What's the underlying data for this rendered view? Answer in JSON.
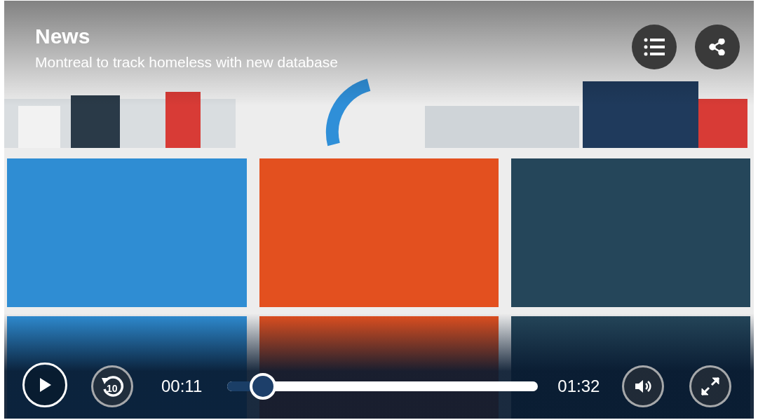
{
  "header": {
    "category": "News",
    "title": "Montreal to track homeless with new database"
  },
  "controls": {
    "playing": false,
    "skip_back": "10",
    "elapsed": "00:11",
    "duration": "01:32",
    "progress": {
      "level": 0.115
    }
  }
}
